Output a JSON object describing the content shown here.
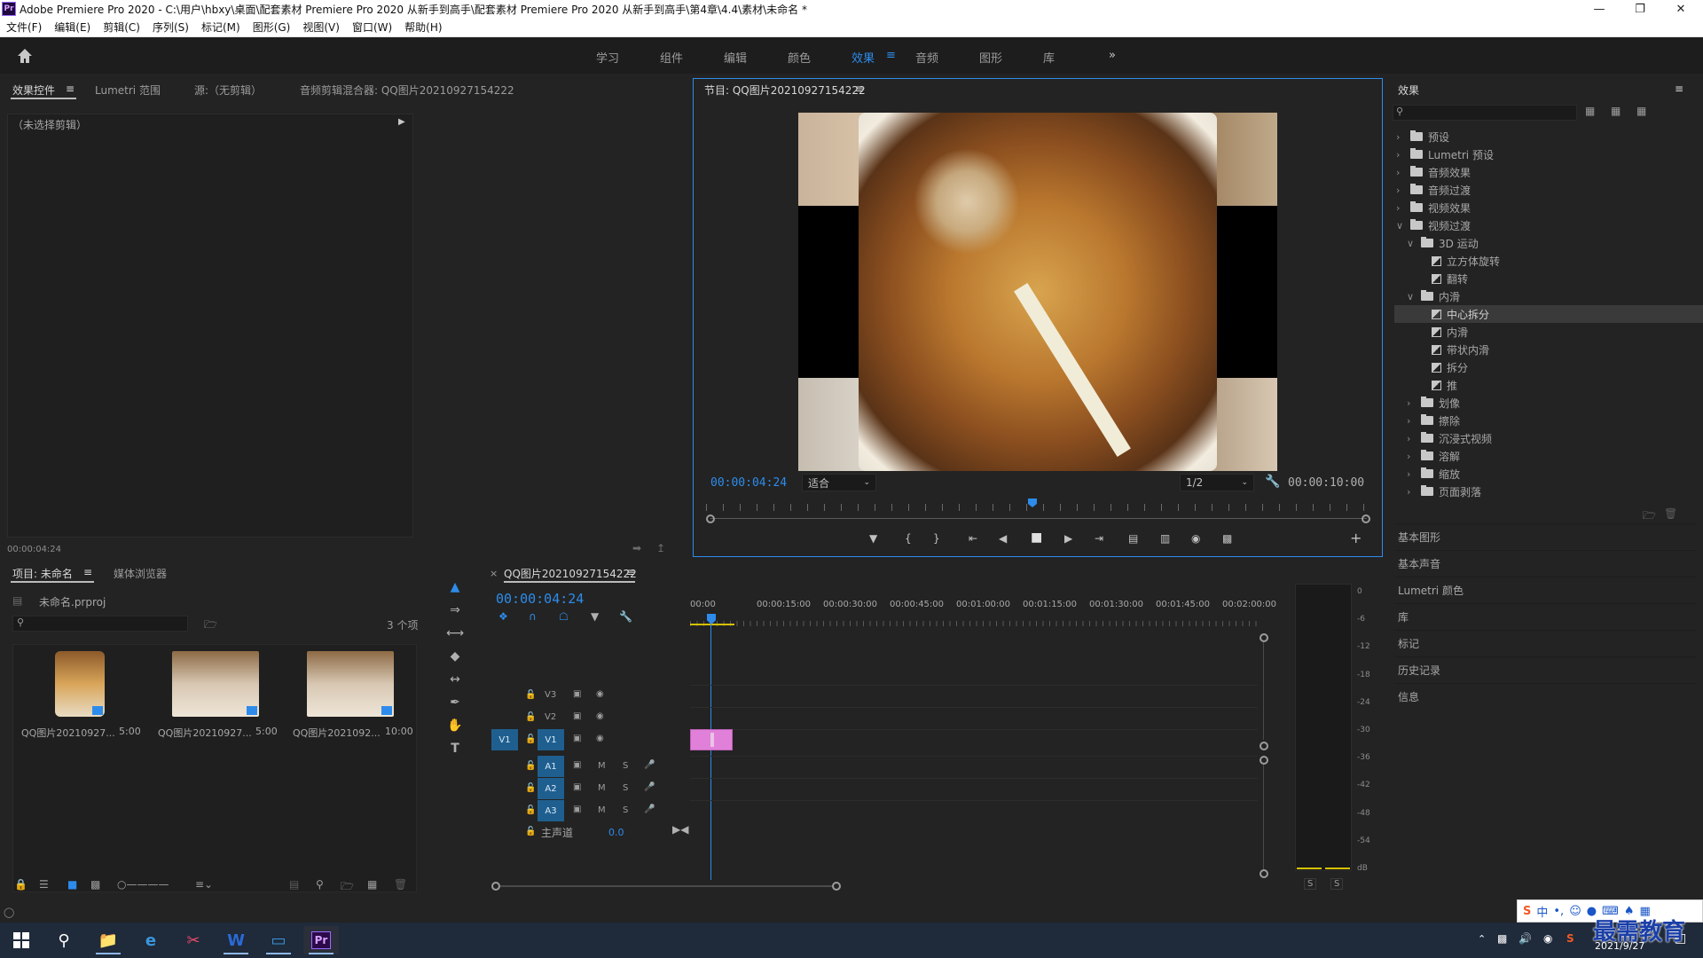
{
  "window": {
    "title": "Adobe Premiere Pro 2020 - C:\\用户\\hbxy\\桌面\\配套素材 Premiere Pro 2020 从新手到高手\\配套素材 Premiere Pro 2020 从新手到高手\\第4章\\4.4\\素材\\未命名 *",
    "app_icon": "Pr"
  },
  "menu": [
    "文件(F)",
    "编辑(E)",
    "剪辑(C)",
    "序列(S)",
    "标记(M)",
    "图形(G)",
    "视图(V)",
    "窗口(W)",
    "帮助(H)"
  ],
  "workspaces": {
    "tabs": [
      "学习",
      "组件",
      "编辑",
      "颜色",
      "效果",
      "音频",
      "图形",
      "库"
    ],
    "active": "效果",
    "overflow": "»"
  },
  "source_panel": {
    "tabs": [
      "效果控件",
      "Lumetri 范围",
      "源:（无剪辑）",
      "音频剪辑混合器: QQ图片20210927154222"
    ],
    "no_clip": "（未选择剪辑）",
    "timecode": "00:00:04:24"
  },
  "program": {
    "title": "节目: QQ图片20210927154222",
    "timecode": "00:00:04:24",
    "fit": "适合",
    "resolution": "1/2",
    "duration": "00:00:10:00"
  },
  "effects_panel": {
    "title": "效果",
    "tree": [
      {
        "label": "预设",
        "level": 0,
        "kind": "folder",
        "open": false
      },
      {
        "label": "Lumetri 预设",
        "level": 0,
        "kind": "folder",
        "open": false
      },
      {
        "label": "音频效果",
        "level": 0,
        "kind": "folder",
        "open": false
      },
      {
        "label": "音频过渡",
        "level": 0,
        "kind": "folder",
        "open": false
      },
      {
        "label": "视频效果",
        "level": 0,
        "kind": "folder",
        "open": false
      },
      {
        "label": "视频过渡",
        "level": 0,
        "kind": "folder",
        "open": true
      },
      {
        "label": "3D 运动",
        "level": 1,
        "kind": "folder",
        "open": true
      },
      {
        "label": "立方体旋转",
        "level": 2,
        "kind": "fx"
      },
      {
        "label": "翻转",
        "level": 2,
        "kind": "fx"
      },
      {
        "label": "内滑",
        "level": 1,
        "kind": "folder",
        "open": true
      },
      {
        "label": "中心拆分",
        "level": 2,
        "kind": "fx",
        "selected": true
      },
      {
        "label": "内滑",
        "level": 2,
        "kind": "fx"
      },
      {
        "label": "带状内滑",
        "level": 2,
        "kind": "fx"
      },
      {
        "label": "拆分",
        "level": 2,
        "kind": "fx"
      },
      {
        "label": "推",
        "level": 2,
        "kind": "fx"
      },
      {
        "label": "划像",
        "level": 1,
        "kind": "folder",
        "open": false
      },
      {
        "label": "擦除",
        "level": 1,
        "kind": "folder",
        "open": false
      },
      {
        "label": "沉浸式视频",
        "level": 1,
        "kind": "folder",
        "open": false
      },
      {
        "label": "溶解",
        "level": 1,
        "kind": "folder",
        "open": false
      },
      {
        "label": "缩放",
        "level": 1,
        "kind": "folder",
        "open": false
      },
      {
        "label": "页面剥落",
        "level": 1,
        "kind": "folder",
        "open": false
      }
    ],
    "side_panels": [
      "基本图形",
      "基本声音",
      "Lumetri 颜色",
      "库",
      "标记",
      "历史记录",
      "信息"
    ]
  },
  "project": {
    "tabs": [
      "项目: 未命名",
      "媒体浏览器"
    ],
    "file": "未命名.prproj",
    "count": "3 个项",
    "items": [
      {
        "name": "QQ图片20210927...",
        "duration": "5:00"
      },
      {
        "name": "QQ图片20210927...",
        "duration": "5:00"
      },
      {
        "name": "QQ图片2021092...",
        "duration": "10:00"
      }
    ]
  },
  "timeline": {
    "tab": "QQ图片20210927154222",
    "close": "×",
    "timecode": "00:00:04:24",
    "ruler": [
      "00:00",
      "00:00:15:00",
      "00:00:30:00",
      "00:00:45:00",
      "00:01:00:00",
      "00:01:15:00",
      "00:01:30:00",
      "00:01:45:00",
      "00:02:00:00"
    ],
    "video_tracks": [
      "V3",
      "V2",
      "V1"
    ],
    "audio_tracks": [
      "A1",
      "A2",
      "A3"
    ],
    "source_patch": "V1",
    "master": "主声道",
    "master_value": "0.0",
    "mute": "M",
    "solo": "S"
  },
  "audio_meter": {
    "scale": [
      "0",
      "-6",
      "-12",
      "-18",
      "-24",
      "-30",
      "-36",
      "-42",
      "-48",
      "-54",
      "dB"
    ],
    "solo": [
      "S",
      "S"
    ]
  },
  "tray": {
    "ime": "中",
    "time": "",
    "date": "2021/9/27",
    "watermark": "最需教育"
  }
}
